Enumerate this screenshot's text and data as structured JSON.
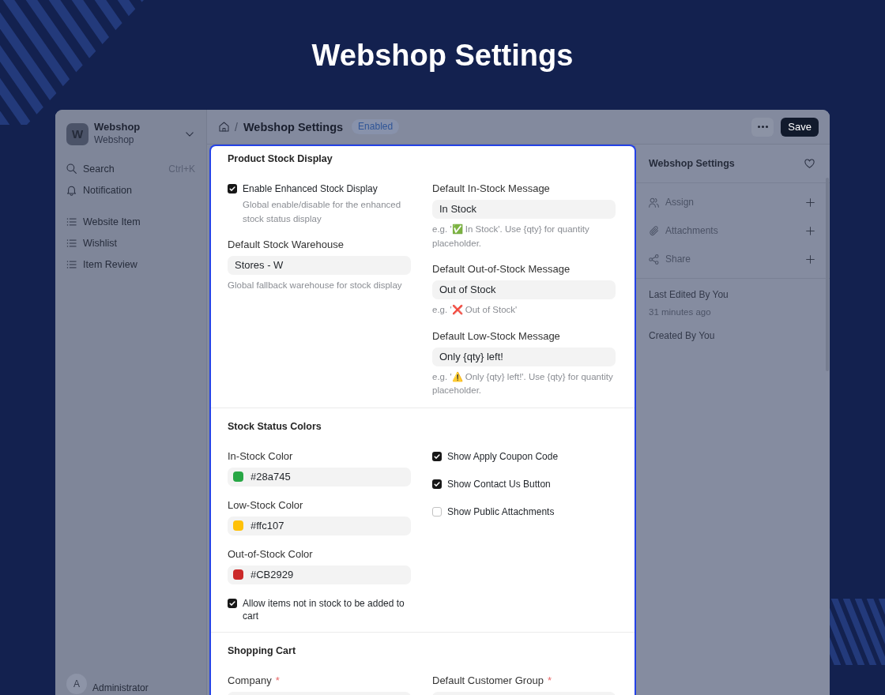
{
  "page_title": "Webshop Settings",
  "sidebar": {
    "app": {
      "initial": "W",
      "name": "Webshop",
      "subtitle": "Webshop"
    },
    "search": {
      "label": "Search",
      "shortcut": "Ctrl+K"
    },
    "notification": {
      "label": "Notification"
    },
    "items": [
      {
        "label": "Website Item"
      },
      {
        "label": "Wishlist"
      },
      {
        "label": "Item Review"
      }
    ],
    "user": {
      "initial": "A",
      "name": "Administrator"
    }
  },
  "header": {
    "separator": "/",
    "title": "Webshop Settings",
    "status": "Enabled",
    "save_button": "Save"
  },
  "form": {
    "sections": [
      {
        "title": "Product Stock Display",
        "columns": [
          [
            {
              "kind": "checkbox",
              "label": "Enable Enhanced Stock Display",
              "checked": true,
              "description": "Global enable/disable for the enhanced stock status display"
            },
            {
              "kind": "input",
              "label": "Default Stock Warehouse",
              "value": "Stores - W",
              "description": "Global fallback warehouse for stock display"
            }
          ],
          [
            {
              "kind": "input",
              "label": "Default In-Stock Message",
              "value": "In Stock",
              "description": "e.g. '✅ In Stock'. Use {qty} for quantity placeholder."
            },
            {
              "kind": "input",
              "label": "Default Out-of-Stock Message",
              "value": "Out of Stock",
              "description": "e.g. '❌ Out of Stock'"
            },
            {
              "kind": "input",
              "label": "Default Low-Stock Message",
              "value": "Only {qty} left!",
              "description": "e.g. '⚠️ Only {qty} left!'. Use {qty} for quantity placeholder."
            }
          ]
        ]
      },
      {
        "title": "Stock Status Colors",
        "columns": [
          [
            {
              "kind": "color",
              "label": "In-Stock Color",
              "value": "#28a745",
              "color": "#28a745"
            },
            {
              "kind": "color",
              "label": "Low-Stock Color",
              "value": "#ffc107",
              "color": "#ffc107"
            },
            {
              "kind": "color",
              "label": "Out-of-Stock Color",
              "value": "#CB2929",
              "color": "#cb2929"
            },
            {
              "kind": "checkbox",
              "label": "Allow items not in stock to be added to cart",
              "checked": true
            }
          ],
          [
            {
              "kind": "checkbox",
              "label": "Show Apply Coupon Code",
              "checked": true
            },
            {
              "kind": "checkbox",
              "label": "Show Contact Us Button",
              "checked": true
            },
            {
              "kind": "checkbox",
              "label": "Show Public Attachments",
              "checked": false
            }
          ]
        ]
      },
      {
        "title": "Shopping Cart",
        "columns": [
          [
            {
              "kind": "input",
              "label": "Company",
              "required_mark": "*"
            }
          ],
          [
            {
              "kind": "input",
              "label": "Default Customer Group",
              "required_mark": "*"
            }
          ]
        ]
      }
    ]
  },
  "side_panel": {
    "title": "Webshop Settings",
    "actions": [
      {
        "label": "Assign"
      },
      {
        "label": "Attachments"
      },
      {
        "label": "Share"
      }
    ],
    "last_edited": "Last Edited By You",
    "edited_time": "31 minutes ago",
    "created": "Created By You"
  }
}
